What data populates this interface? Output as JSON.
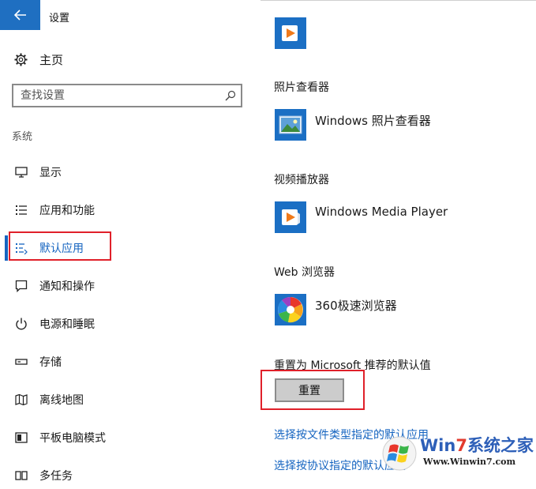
{
  "window": {
    "title": "设置"
  },
  "home": {
    "label": "主页"
  },
  "search": {
    "placeholder": "查找设置"
  },
  "sidebar": {
    "section": "系统",
    "items": [
      {
        "label": "显示",
        "icon": "monitor-icon"
      },
      {
        "label": "应用和功能",
        "icon": "apps-list-icon"
      },
      {
        "label": "默认应用",
        "icon": "default-apps-icon",
        "selected": true
      },
      {
        "label": "通知和操作",
        "icon": "notification-icon"
      },
      {
        "label": "电源和睡眠",
        "icon": "power-icon"
      },
      {
        "label": "存储",
        "icon": "storage-icon"
      },
      {
        "label": "离线地图",
        "icon": "map-icon"
      },
      {
        "label": "平板电脑模式",
        "icon": "tablet-icon"
      },
      {
        "label": "多任务",
        "icon": "multitask-icon"
      }
    ]
  },
  "main": {
    "photo": {
      "title": "照片查看器",
      "app": "Windows 照片查看器",
      "icon": "photo-viewer-icon"
    },
    "video": {
      "title": "视频播放器",
      "app": "Windows Media Player",
      "icon": "media-player-icon"
    },
    "browser": {
      "title": "Web 浏览器",
      "app": "360极速浏览器",
      "icon": "browser-360-icon"
    },
    "reset": {
      "title": "重置为 Microsoft 推荐的默认值",
      "button": "重置"
    },
    "links": [
      "选择按文件类型指定的默认应用",
      "选择按协议指定的默认应用"
    ]
  },
  "watermark": {
    "brand_prefix": "Win",
    "brand_seven": "7",
    "brand_suffix": "系统之家",
    "url": "Www.Winwin7.com"
  },
  "colors": {
    "accent": "#1564c0",
    "tile": "#1b6fc4",
    "highlight": "#e0202a"
  }
}
